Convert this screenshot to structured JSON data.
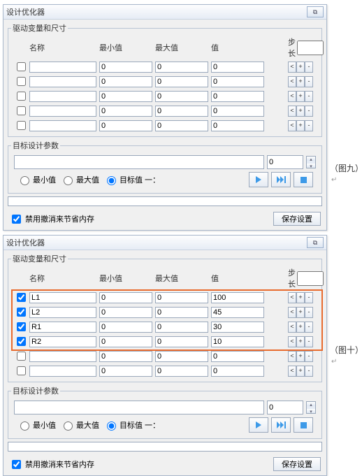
{
  "captions": {
    "fig9": "（图九）",
    "fig10": "（图十）",
    "ret": "↵"
  },
  "dialog1": {
    "title": "设计优化器",
    "closeGlyph": "⧉",
    "fieldset1_legend": "驱动变量和尺寸",
    "headers": {
      "name": "名称",
      "min": "最小值",
      "max": "最大值",
      "val": "值",
      "step": "步长"
    },
    "step_value": "",
    "rows": [
      {
        "chk": false,
        "name": "",
        "min": "0",
        "max": "0",
        "val": "0"
      },
      {
        "chk": false,
        "name": "",
        "min": "0",
        "max": "0",
        "val": "0"
      },
      {
        "chk": false,
        "name": "",
        "min": "0",
        "max": "0",
        "val": "0"
      },
      {
        "chk": false,
        "name": "",
        "min": "0",
        "max": "0",
        "val": "0"
      },
      {
        "chk": false,
        "name": "",
        "min": "0",
        "max": "0",
        "val": "0"
      }
    ],
    "tiny_labels": [
      "<",
      "+",
      "-"
    ],
    "fieldset2_legend": "目标设计参数",
    "target": {
      "long": "",
      "short": "0"
    },
    "opts": {
      "min": "最小值",
      "max": "最大值",
      "tgt": "目标值 一：",
      "selected": "tgt"
    },
    "bottom": {
      "chk_label": "禁用撤消来节省内存",
      "chk": true,
      "save": "保存设置"
    }
  },
  "dialog2": {
    "title": "设计优化器",
    "closeGlyph": "⧉",
    "fieldset1_legend": "驱动变量和尺寸",
    "headers": {
      "name": "名称",
      "min": "最小值",
      "max": "最大值",
      "val": "值",
      "step": "步长"
    },
    "step_value": "",
    "rows": [
      {
        "chk": true,
        "name": "L1",
        "min": "0",
        "max": "0",
        "val": "100"
      },
      {
        "chk": true,
        "name": "L2",
        "min": "0",
        "max": "0",
        "val": "45"
      },
      {
        "chk": true,
        "name": "R1",
        "min": "0",
        "max": "0",
        "val": "30"
      },
      {
        "chk": true,
        "name": "R2",
        "min": "0",
        "max": "0",
        "val": "10"
      },
      {
        "chk": false,
        "name": "",
        "min": "0",
        "max": "0",
        "val": "0"
      },
      {
        "chk": false,
        "name": "",
        "min": "0",
        "max": "0",
        "val": "0"
      }
    ],
    "tiny_labels": [
      "<",
      "+",
      "-"
    ],
    "fieldset2_legend": "目标设计参数",
    "target": {
      "long": "",
      "short": "0"
    },
    "opts": {
      "min": "最小值",
      "max": "最大值",
      "tgt": "目标值 一：",
      "selected": "tgt"
    },
    "bottom": {
      "chk_label": "禁用撤消来节省内存",
      "chk": true,
      "save": "保存设置"
    }
  }
}
